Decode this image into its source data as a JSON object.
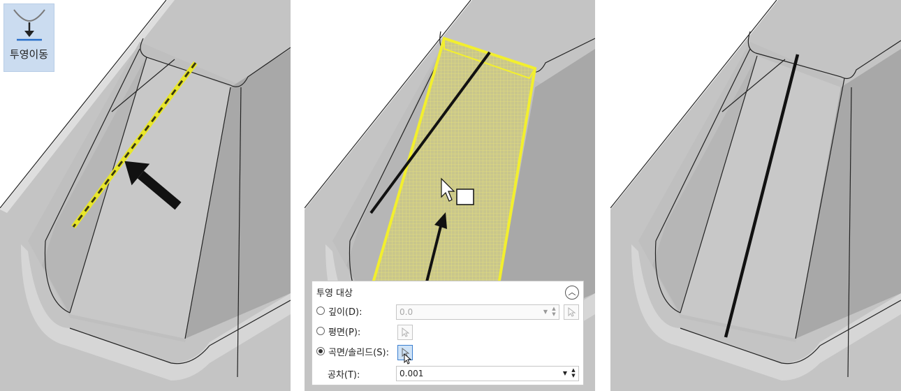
{
  "ribbon": {
    "label": "투영이동",
    "icon": "project-move-icon"
  },
  "dialog": {
    "title": "투영 대상",
    "depth_label": "깊이(D):",
    "depth_value": "0.0",
    "plane_label": "평면(P):",
    "surface_label": "곡면/솔리드(S):",
    "tolerance_label": "공차(T):",
    "tolerance_value": "0.001",
    "selected": "surface"
  },
  "colors": {
    "highlight": "#f2ef2e",
    "body": "#c8c8c8",
    "accent": "#3b7fd0"
  }
}
